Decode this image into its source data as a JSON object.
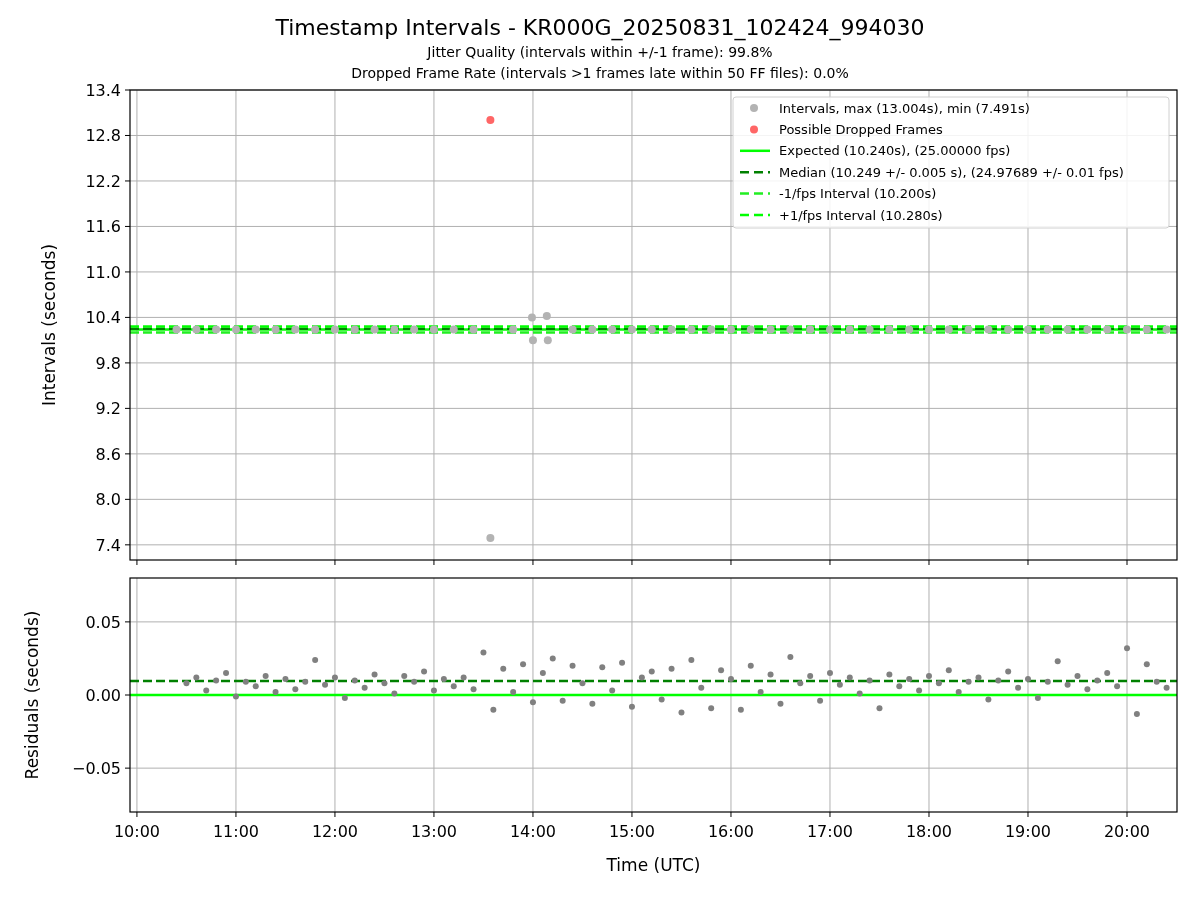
{
  "figure": {
    "title": "Timestamp Intervals - KR000G_20250831_102424_994030",
    "subtitles": [
      "Jitter Quality (intervals within +/-1 frame): 99.8%",
      "Dropped Frame Rate (intervals >1 frames late within 50 FF files): 0.0%"
    ]
  },
  "intervals_plot": {
    "chart_data": {
      "type": "scatter",
      "ylabel": "Intervals (seconds)",
      "x": [
        10.4,
        10.6,
        10.8,
        11.0,
        11.2,
        11.4,
        11.6,
        11.8,
        12.0,
        12.2,
        12.4,
        12.6,
        12.8,
        13.0,
        13.2,
        13.4,
        13.57,
        13.8,
        13.99,
        14.0,
        14.14,
        14.15,
        14.4,
        14.6,
        14.8,
        15.0,
        15.2,
        15.4,
        15.6,
        15.8,
        16.0,
        16.2,
        16.4,
        16.6,
        16.8,
        17.0,
        17.2,
        17.4,
        17.6,
        17.8,
        18.0,
        18.2,
        18.4,
        18.6,
        18.8,
        19.0,
        19.2,
        19.4,
        19.6,
        19.8,
        20.0,
        20.2,
        20.4
      ],
      "series": [
        {
          "name": "Intervals, max (13.004s), min (7.491s)",
          "color": "#b3b3b3",
          "values": [
            10.24,
            10.24,
            10.24,
            10.24,
            10.24,
            10.24,
            10.24,
            10.24,
            10.24,
            10.24,
            10.24,
            10.24,
            10.24,
            10.24,
            10.24,
            10.24,
            7.491,
            10.24,
            10.4,
            10.1,
            10.42,
            10.1,
            10.24,
            10.24,
            10.24,
            10.24,
            10.24,
            10.24,
            10.24,
            10.24,
            10.24,
            10.24,
            10.24,
            10.24,
            10.24,
            10.24,
            10.24,
            10.24,
            10.24,
            10.24,
            10.24,
            10.24,
            10.24,
            10.24,
            10.24,
            10.24,
            10.24,
            10.24,
            10.24,
            10.24,
            10.24,
            10.24,
            10.24
          ]
        },
        {
          "name": "Possible Dropped Frames",
          "color": "#ff6666",
          "values": [
            null,
            null,
            null,
            null,
            null,
            null,
            null,
            null,
            null,
            null,
            null,
            null,
            null,
            null,
            null,
            null,
            13.004,
            null,
            null,
            null,
            null,
            null,
            null,
            null,
            null,
            null,
            null,
            null,
            null,
            null,
            null,
            null,
            null,
            null,
            null,
            null,
            null,
            null,
            null,
            null,
            null,
            null,
            null,
            null,
            null,
            null,
            null,
            null,
            null,
            null,
            null,
            null,
            null
          ]
        }
      ],
      "xlim": [
        9.93,
        20.505
      ],
      "ylim": [
        7.2,
        13.4
      ],
      "grid": true,
      "legend": true,
      "yticks": [
        {
          "value": 7.4,
          "label": "7.4"
        },
        {
          "value": 8.0,
          "label": "8.0"
        },
        {
          "value": 8.6,
          "label": "8.6"
        },
        {
          "value": 9.2,
          "label": "9.2"
        },
        {
          "value": 9.8,
          "label": "9.8"
        },
        {
          "value": 10.4,
          "label": "10.4"
        },
        {
          "value": 11.0,
          "label": "11.0"
        },
        {
          "value": 11.6,
          "label": "11.6"
        },
        {
          "value": 12.2,
          "label": "12.2"
        },
        {
          "value": 12.8,
          "label": "12.8"
        },
        {
          "value": 13.4,
          "label": "13.4"
        }
      ],
      "ref_lines": [
        {
          "axis": "y",
          "value": 10.24,
          "label": "Expected (10.240s), (25.00000 fps)",
          "color": "#00ff00"
        },
        {
          "axis": "y",
          "value": 10.249,
          "label": "Median (10.249 +/- 0.005 s), (24.97689 +/- 0.01 fps)",
          "color": "#008000"
        },
        {
          "axis": "y",
          "value": 10.2,
          "label": "-1/fps Interval (10.200s)",
          "color": "#22ee22"
        },
        {
          "axis": "y",
          "value": 10.28,
          "label": "+1/fps Interval (10.280s)",
          "color": "#00ff00"
        }
      ]
    }
  },
  "residuals_plot": {
    "chart_data": {
      "type": "scatter",
      "xlabel": "Time (UTC)",
      "ylabel": "Residuals (seconds)",
      "x": [
        10.5,
        10.6,
        10.7,
        10.8,
        10.9,
        11.0,
        11.1,
        11.2,
        11.3,
        11.4,
        11.5,
        11.6,
        11.7,
        11.8,
        11.9,
        12.0,
        12.1,
        12.2,
        12.3,
        12.4,
        12.5,
        12.6,
        12.7,
        12.8,
        12.9,
        13.0,
        13.1,
        13.2,
        13.3,
        13.4,
        13.5,
        13.6,
        13.7,
        13.8,
        13.9,
        14.0,
        14.1,
        14.2,
        14.3,
        14.4,
        14.5,
        14.6,
        14.7,
        14.8,
        14.9,
        15.0,
        15.1,
        15.2,
        15.3,
        15.4,
        15.5,
        15.6,
        15.7,
        15.8,
        15.9,
        16.0,
        16.1,
        16.2,
        16.3,
        16.4,
        16.5,
        16.6,
        16.7,
        16.8,
        16.9,
        17.0,
        17.1,
        17.2,
        17.3,
        17.4,
        17.5,
        17.6,
        17.7,
        17.8,
        17.9,
        18.0,
        18.1,
        18.2,
        18.3,
        18.4,
        18.5,
        18.6,
        18.7,
        18.8,
        18.9,
        19.0,
        19.1,
        19.2,
        19.3,
        19.4,
        19.5,
        19.6,
        19.7,
        19.8,
        19.9,
        20.0,
        20.1,
        20.2,
        20.3,
        20.4
      ],
      "grid": true,
      "series": [
        {
          "color": "#808080",
          "values": [
            0.008,
            0.012,
            0.003,
            0.01,
            0.015,
            -0.001,
            0.009,
            0.006,
            0.013,
            0.002,
            0.011,
            0.004,
            0.009,
            0.024,
            0.007,
            0.012,
            -0.002,
            0.01,
            0.005,
            0.014,
            0.008,
            0.001,
            0.013,
            0.009,
            0.016,
            0.003,
            0.011,
            0.006,
            0.012,
            0.004,
            0.029,
            -0.01,
            0.018,
            0.002,
            0.021,
            -0.005,
            0.015,
            0.025,
            -0.004,
            0.02,
            0.008,
            -0.006,
            0.019,
            0.003,
            0.022,
            -0.008,
            0.012,
            0.016,
            -0.003,
            0.018,
            -0.012,
            0.024,
            0.005,
            -0.009,
            0.017,
            0.011,
            -0.01,
            0.02,
            0.002,
            0.014,
            -0.006,
            0.026,
            0.008,
            0.013,
            -0.004,
            0.015,
            0.007,
            0.012,
            0.001,
            0.01,
            -0.009,
            0.014,
            0.006,
            0.011,
            0.003,
            0.013,
            0.008,
            0.017,
            0.002,
            0.009,
            0.012,
            -0.003,
            0.01,
            0.016,
            0.005,
            0.011,
            -0.002,
            0.009,
            0.023,
            0.007,
            0.013,
            0.004,
            0.01,
            0.015,
            0.006,
            0.032,
            -0.013,
            0.021,
            0.009,
            0.005
          ]
        }
      ],
      "xlim": [
        9.93,
        20.505
      ],
      "ylim": [
        -0.08,
        0.08
      ],
      "xticks": [
        {
          "value": 10,
          "label": "10:00"
        },
        {
          "value": 11,
          "label": "11:00"
        },
        {
          "value": 12,
          "label": "12:00"
        },
        {
          "value": 13,
          "label": "13:00"
        },
        {
          "value": 14,
          "label": "14:00"
        },
        {
          "value": 15,
          "label": "15:00"
        },
        {
          "value": 16,
          "label": "16:00"
        },
        {
          "value": 17,
          "label": "17:00"
        },
        {
          "value": 18,
          "label": "18:00"
        },
        {
          "value": 19,
          "label": "19:00"
        },
        {
          "value": 20,
          "label": "20:00"
        }
      ],
      "yticks": [
        {
          "value": -0.05,
          "label": "−0.05"
        },
        {
          "value": 0,
          "label": "0.00"
        },
        {
          "value": 0.05,
          "label": "0.05"
        }
      ],
      "ref_lines": [
        {
          "axis": "y",
          "value": 0.0096,
          "color": "#008000"
        },
        {
          "axis": "y",
          "value": 0,
          "color": "#00ff00"
        }
      ]
    }
  }
}
